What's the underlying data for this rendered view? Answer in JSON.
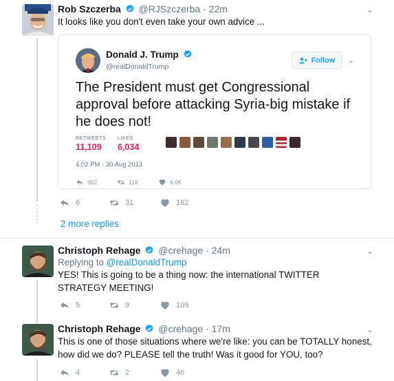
{
  "tweet1": {
    "name": "Rob Szczerba",
    "handle": "@RJSzczerba",
    "dot": "·",
    "time": "22m",
    "text": "It looks like you don't even take your own advice ...",
    "reply_count": "6",
    "retweet_count": "31",
    "like_count": "162"
  },
  "quoted": {
    "name": "Donald J. Trump",
    "handle": "@realDonaldTrump",
    "follow_label": "Follow",
    "text": "The President must get Congressional approval before attacking Syria-big mistake if he does not!",
    "retweets_label": "RETWEETS",
    "retweets_value": "11,109",
    "likes_label": "LIKES",
    "likes_value": "6,034",
    "timestamp": "4:02 PM - 30 Aug 2013",
    "reply_count": "962",
    "retweet_count": "11K",
    "like_count": "6.0K"
  },
  "more_replies": "2 more replies",
  "tweet2": {
    "name": "Christoph Rehage",
    "handle": "@crehage",
    "dot": "·",
    "time": "24m",
    "replying_prefix": "Replying to",
    "replying_to": "@realDonaldTrump",
    "text": "YES! This is going to be a thing now: the international TWITTER STRATEGY MEETING!",
    "reply_count": "5",
    "retweet_count": "9",
    "like_count": "109"
  },
  "tweet3": {
    "name": "Christoph Rehage",
    "handle": "@crehage",
    "dot": "·",
    "time": "17m",
    "text": "This is one of those situations where we're like: you can be TOTALLY honest, how did we do? PLEASE tell the truth! Was it good for YOU, too?",
    "reply_count": "4",
    "retweet_count": "2",
    "like_count": "46"
  },
  "icons": {
    "verified": "verified-badge-icon",
    "reply": "reply-icon",
    "retweet": "retweet-icon",
    "like": "heart-icon",
    "chevron": "chevron-down-icon",
    "follow": "add-user-icon"
  },
  "colors": {
    "accent": "#1da1f2",
    "link": "#1b95e0",
    "stat_value": "#e0245e",
    "muted": "#657786",
    "thread_line": "#ccd6dd"
  }
}
